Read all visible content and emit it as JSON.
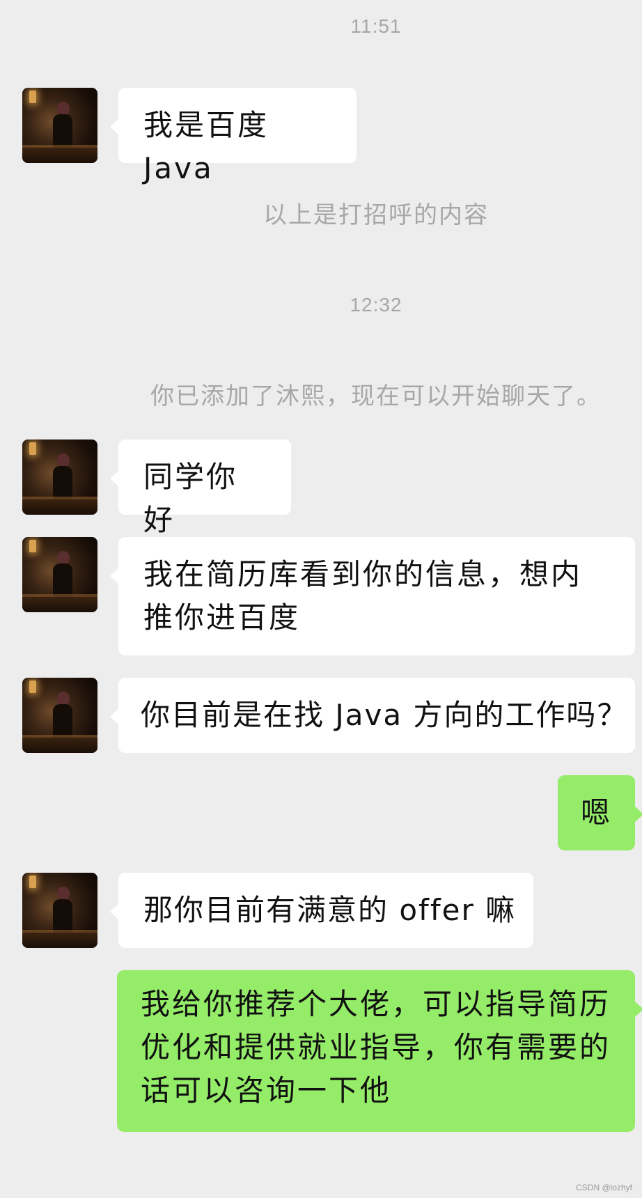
{
  "chat": {
    "time_1": "11:51",
    "msg_1": "我是百度 Java",
    "sys_1": "以上是打招呼的内容",
    "time_2": "12:32",
    "sys_2": "你已添加了沐熙，现在可以开始聊天了。",
    "msg_2": "同学你好",
    "msg_3": "我在简历库看到你的信息，想内推你进百度",
    "msg_4": "你目前是在找 Java 方向的工作吗？",
    "msg_5": "嗯",
    "msg_6": "那你目前有满意的 offer 嘛",
    "msg_7": "我给你推荐个大佬，可以指导简历优化和提供就业指导，你有需要的话可以咨询一下他"
  },
  "watermark": "CSDN @lozhyf",
  "colors": {
    "background": "#ededed",
    "incoming_bubble": "#ffffff",
    "outgoing_bubble": "#95ec69",
    "meta_text": "#a7a7a7"
  }
}
